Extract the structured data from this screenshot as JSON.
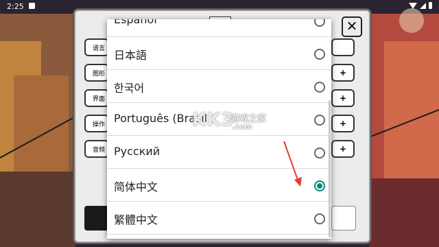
{
  "status_bar": {
    "time": "2:25",
    "icons": [
      "notification-icon",
      "wifi-icon",
      "signal-icon",
      "battery-icon"
    ]
  },
  "settings": {
    "title": "",
    "close_glyph": "✕",
    "rows": [
      {
        "label": "语言",
        "control": ""
      },
      {
        "label": "图形",
        "control": "+"
      },
      {
        "label": "界面",
        "control": "+"
      },
      {
        "label": "操作",
        "control": "+"
      },
      {
        "label": "音频",
        "control": "+"
      }
    ]
  },
  "language_dialog": {
    "options": [
      {
        "label": "Español",
        "selected": false
      },
      {
        "label": "日本語",
        "selected": false
      },
      {
        "label": "한국어",
        "selected": false
      },
      {
        "label": "Português (Brasil)",
        "selected": false
      },
      {
        "label": "Русский",
        "selected": false
      },
      {
        "label": "简体中文",
        "selected": true
      },
      {
        "label": "繁體中文",
        "selected": false
      }
    ]
  },
  "watermark": {
    "logo": "KK3",
    "cn": "游戏之家",
    "com": ".com"
  },
  "colors": {
    "accent": "#00897b",
    "arrow": "#e53935"
  }
}
